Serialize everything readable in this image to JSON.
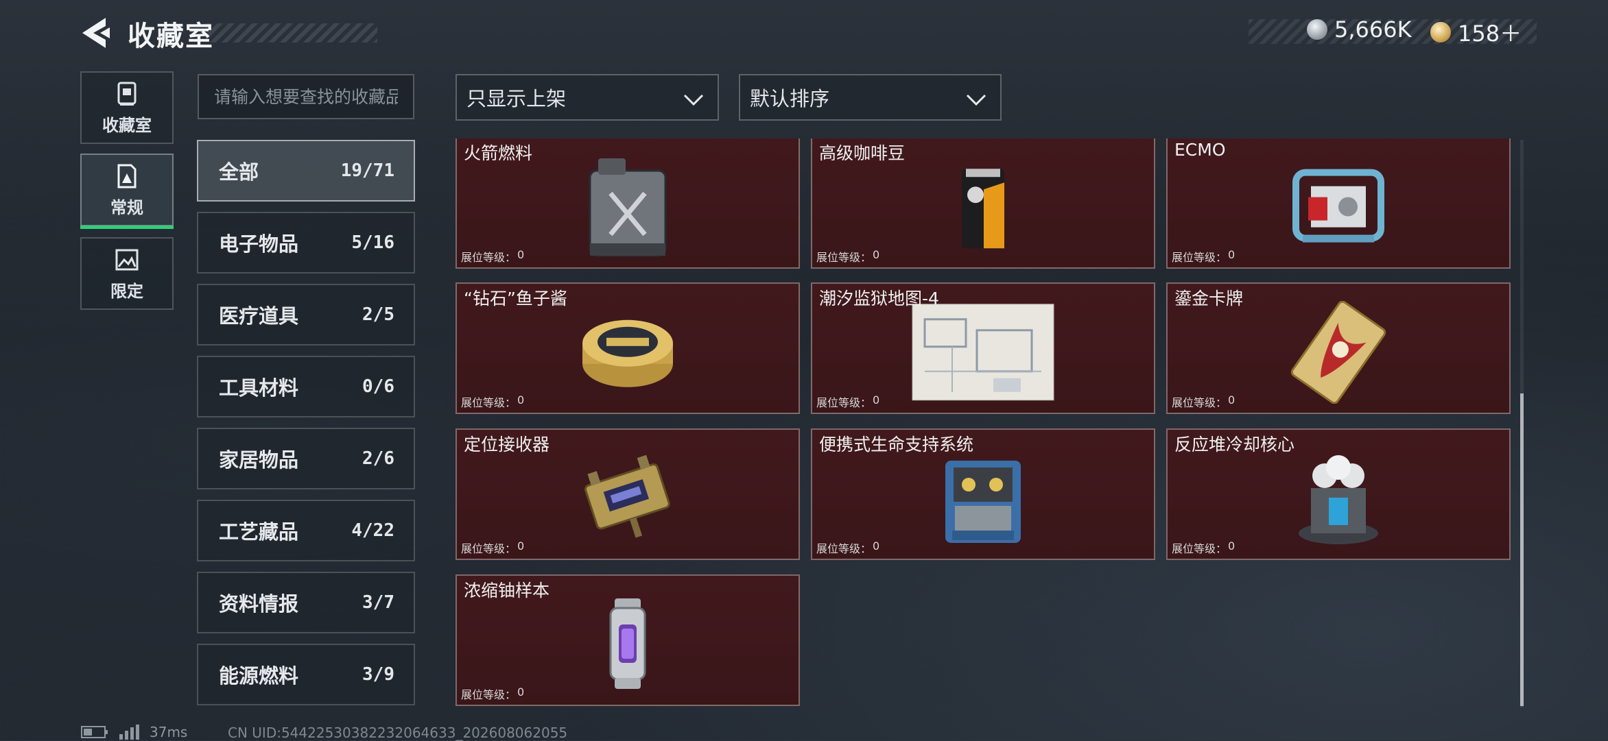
{
  "header": {
    "title": "收藏室",
    "currencies": [
      {
        "icon": "silver-coin-icon",
        "value": "5,666K"
      },
      {
        "icon": "gold-coin-icon",
        "value": "158＋"
      }
    ]
  },
  "nav": {
    "tabs": [
      {
        "label": "收藏室",
        "icon": "vault-icon"
      },
      {
        "label": "常规",
        "icon": "document-icon",
        "active": true
      },
      {
        "label": "限定",
        "icon": "picture-icon"
      }
    ]
  },
  "search": {
    "placeholder": "请输入想要查找的收藏品"
  },
  "filters": {
    "display": "只显示上架",
    "sort": "默认排序"
  },
  "categories": [
    {
      "name": "全部",
      "count": "19/71",
      "active": true
    },
    {
      "name": "电子物品",
      "count": "5/16"
    },
    {
      "name": "医疗道具",
      "count": "2/5"
    },
    {
      "name": "工具材料",
      "count": "0/6"
    },
    {
      "name": "家居物品",
      "count": "2/6"
    },
    {
      "name": "工艺藏品",
      "count": "4/22"
    },
    {
      "name": "资料情报",
      "count": "3/7"
    },
    {
      "name": "能源燃料",
      "count": "3/9"
    }
  ],
  "level_label": "展位等级：",
  "items": [
    {
      "name": "火箭燃料",
      "level": "0",
      "icon": "jerrycan-icon"
    },
    {
      "name": "高级咖啡豆",
      "level": "0",
      "icon": "coffee-bag-icon"
    },
    {
      "name": "ECMO",
      "level": "0",
      "icon": "ecmo-machine-icon"
    },
    {
      "name": "“钻石”鱼子酱",
      "level": "0",
      "icon": "caviar-tin-icon"
    },
    {
      "name": "潮汐监狱地图-4",
      "level": "0",
      "icon": "map-icon"
    },
    {
      "name": "鎏金卡牌",
      "level": "0",
      "icon": "gold-card-icon"
    },
    {
      "name": "定位接收器",
      "level": "0",
      "icon": "receiver-icon"
    },
    {
      "name": "便携式生命支持系统",
      "level": "0",
      "icon": "life-support-icon"
    },
    {
      "name": "反应堆冷却核心",
      "level": "0",
      "icon": "reactor-core-icon"
    },
    {
      "name": "浓缩铀样本",
      "level": "0",
      "icon": "uranium-capsule-icon"
    }
  ],
  "footer": {
    "ping": "37ms",
    "uid": "CN UID:5442253038223206463‌3_202608062055"
  }
}
